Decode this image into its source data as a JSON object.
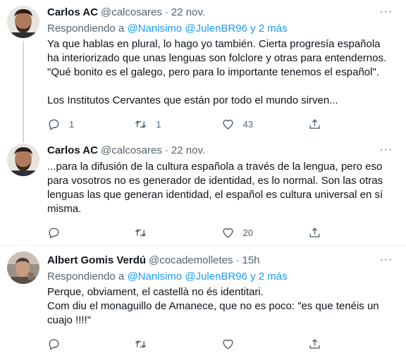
{
  "tweets": [
    {
      "name": "Carlos AC",
      "handle": "@calcosares",
      "separator": "·",
      "time": "22 nov.",
      "more": "···",
      "reply_prefix": "Respondiendo a",
      "reply_mentions": "@Nanisimo @JulenBR96 y 2 más",
      "text": "Ya que hablas en plural, lo hago yo también. Cierta progresía española ha interiorizado que unas lenguas son folclore y otras para entendernos. \"Qué bonito es el galego, pero para lo importante tenemos el español\".\n\nLos Institutos Cervantes que están por todo el mundo sirven...",
      "replies": "1",
      "retweets": "1",
      "likes": "43"
    },
    {
      "name": "Carlos AC",
      "handle": "@calcosares",
      "separator": "·",
      "time": "22 nov.",
      "more": "···",
      "text": "...para la difusión de la cultura española a través de la lengua, pero eso para vosotros no es generador de identidad, es lo normal. Son las otras lenguas las que generan identidad, el español es cultura universal en sí misma.",
      "replies": "",
      "retweets": "",
      "likes": "20"
    },
    {
      "name": "Albert Gomis Verdú",
      "handle": "@cocademolletes",
      "separator": "·",
      "time": "15h",
      "more": "···",
      "reply_prefix": "Respondiendo a",
      "reply_mentions": "@Nanisimo @JulenBR96 y 2 más",
      "text": "Perque, obviament, el castellà no és identitari.\nCom diu el monaguillo de Amanece, que no es poco: \"es que tenéis un cuajo !!!!\"",
      "replies": "",
      "retweets": "",
      "likes": ""
    }
  ],
  "icons": [
    "reply-icon",
    "retweet-icon",
    "like-icon",
    "share-icon"
  ],
  "colors": {
    "link": "#1d9bf0",
    "secondary": "#536471",
    "thread_line": "#cfd9de"
  }
}
